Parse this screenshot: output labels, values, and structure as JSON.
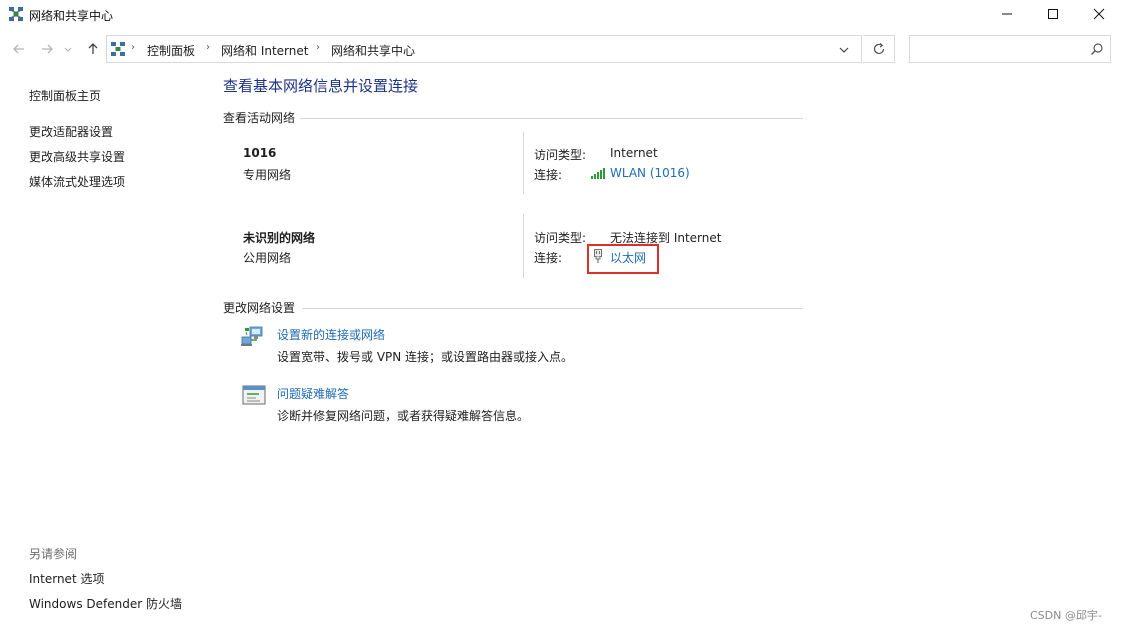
{
  "window": {
    "title": "网络和共享中心",
    "icon": "network-icon"
  },
  "nav": {
    "breadcrumbs": [
      "控制面板",
      "网络和 Internet",
      "网络和共享中心"
    ],
    "search_placeholder": ""
  },
  "sidebar": {
    "links": [
      "控制面板主页",
      "更改适配器设置",
      "更改高级共享设置",
      "媒体流式处理选项"
    ],
    "see_also_title": "另请参阅",
    "see_also_links": [
      "Internet 选项",
      "Windows Defender 防火墙"
    ]
  },
  "main": {
    "title": "查看基本网络信息并设置连接",
    "active_networks_title": "查看活动网络",
    "networks": [
      {
        "name": "1016",
        "type": "专用网络",
        "access_label": "访问类型:",
        "access_value": "Internet",
        "connection_label": "连接:",
        "connection_value": "WLAN (1016)",
        "connection_icon": "wifi-signal-icon"
      },
      {
        "name": "未识别的网络",
        "type": "公用网络",
        "access_label": "访问类型:",
        "access_value": "无法连接到 Internet",
        "connection_label": "连接:",
        "connection_value": "以太网",
        "connection_icon": "ethernet-plug-icon"
      }
    ],
    "change_settings_title": "更改网络设置",
    "tasks": [
      {
        "link": "设置新的连接或网络",
        "desc": "设置宽带、拨号或 VPN 连接；或设置路由器或接入点。",
        "icon": "new-connection-icon"
      },
      {
        "link": "问题疑难解答",
        "desc": "诊断并修复网络问题，或者获得疑难解答信息。",
        "icon": "troubleshoot-icon"
      }
    ]
  },
  "watermark": "CSDN @邱宇-",
  "colors": {
    "link": "#1e6bb8",
    "page_title": "#1e3287",
    "highlight": "#d9322e"
  }
}
